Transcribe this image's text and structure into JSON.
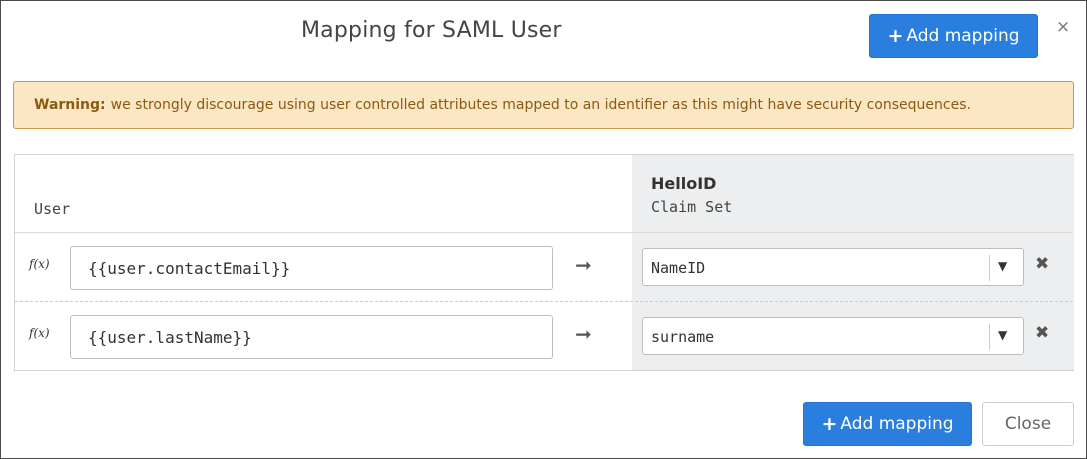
{
  "dialog": {
    "title": "Mapping for SAML User",
    "add_mapping_label": "Add mapping",
    "add_mapping_plus": "+",
    "close_icon": "×"
  },
  "warning": {
    "strong": "Warning:",
    "message": "we strongly discourage using user controlled attributes mapped to an identifier as this might have security consequences."
  },
  "table": {
    "source_header": "User",
    "target_app": "HelloID",
    "target_header": "Claim Set",
    "rows": [
      {
        "fx_label": "f(x)",
        "expression": "{{user.contactEmail}}",
        "arrow": "➞",
        "claim": "NameID",
        "caret": "▼",
        "remove": "✖"
      },
      {
        "fx_label": "f(x)",
        "expression": "{{user.lastName}}",
        "arrow": "➞",
        "claim": "surname",
        "caret": "▼",
        "remove": "✖"
      }
    ]
  },
  "footer": {
    "add_mapping_label": "Add mapping",
    "add_mapping_plus": "+",
    "close_label": "Close"
  },
  "colors": {
    "primary": "#2a7fde",
    "warning_bg": "#fce7c4",
    "warning_text": "#8a5a12"
  }
}
